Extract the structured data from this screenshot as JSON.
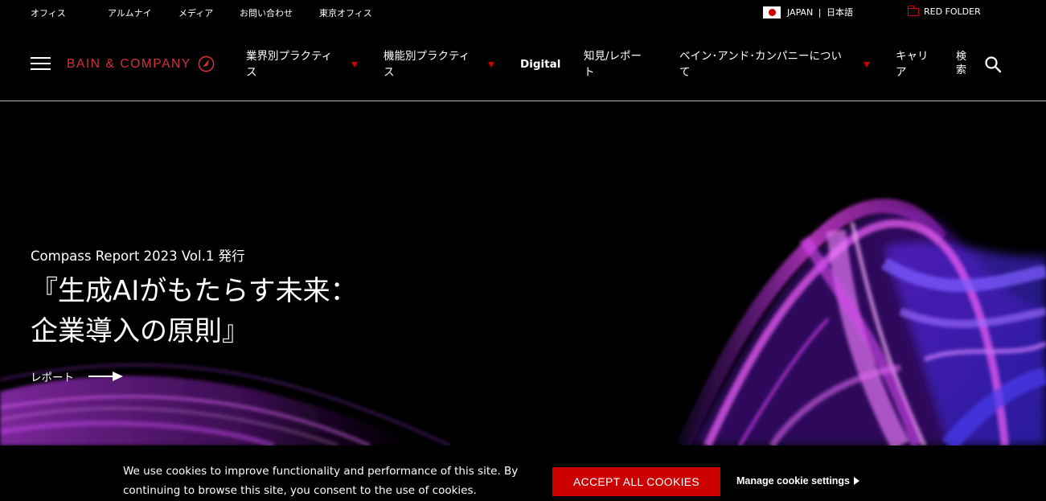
{
  "utility": {
    "links": [
      "オフィス",
      "アルムナイ",
      "メディア",
      "お問い合わせ",
      "東京オフィス"
    ],
    "locale": {
      "country": "JAPAN",
      "separator": "|",
      "language": "日本語"
    },
    "red_folder": "RED FOLDER"
  },
  "brand": {
    "name": "BAIN & COMPANY",
    "accent": "#cc0000",
    "logo_color": "#d6313a"
  },
  "nav": {
    "items": [
      {
        "line1": "業界別プラクティ",
        "line2": "ス",
        "dropdown": true
      },
      {
        "line1": "機能別プラクティ",
        "line2": "ス",
        "dropdown": true
      },
      {
        "line1": "Digital",
        "line2": "",
        "dropdown": false
      },
      {
        "line1": "知見/レポー",
        "line2": "ト",
        "dropdown": false
      },
      {
        "line1": "ベイン･アンド･カンパニーについ",
        "line2": "て",
        "dropdown": true
      },
      {
        "line1": "キャリ",
        "line2": "ア",
        "dropdown": false
      },
      {
        "line1": "検",
        "line2": "索",
        "dropdown": false
      }
    ]
  },
  "hero": {
    "kicker": "Compass Report 2023 Vol.1 発行",
    "title_line1": "『生成AIがもたらす未来：",
    "title_line2": "企業導入の原則』",
    "cta": "レポート"
  },
  "cookie": {
    "line1": "We use cookies to improve functionality and performance of this site. By",
    "line2": "continuing to browse this site, you consent to the use of cookies.",
    "accept": "ACCEPT ALL COOKIES",
    "manage": "Manage cookie settings"
  }
}
